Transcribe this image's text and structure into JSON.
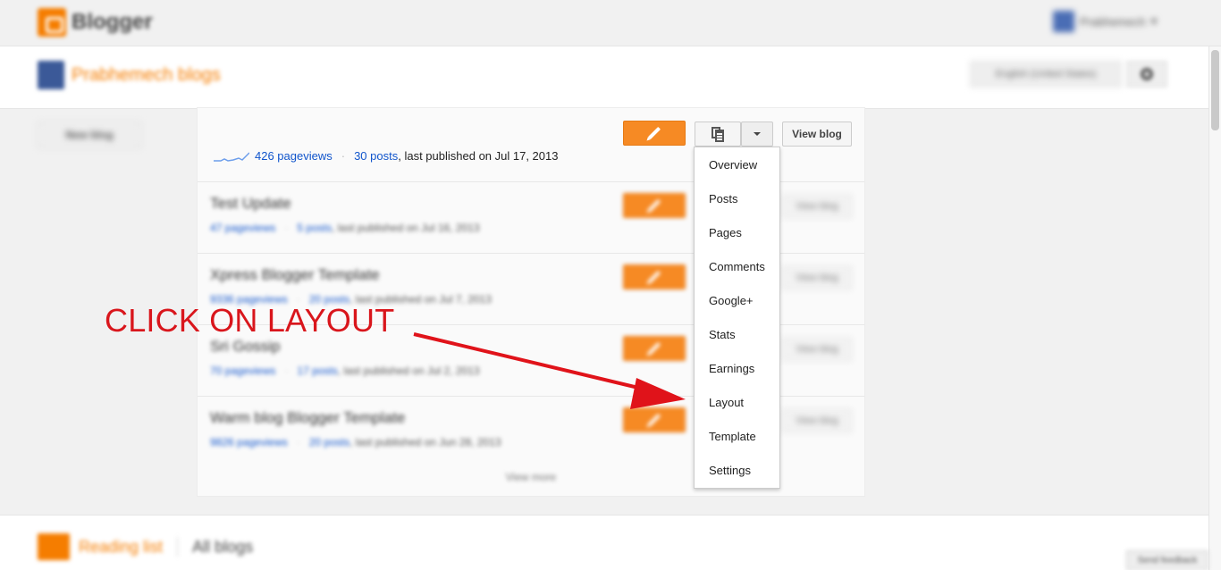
{
  "header": {
    "app_name": "Blogger",
    "user_name": "Prabhemech"
  },
  "profile": {
    "name": "Prabhemech blogs",
    "language": "English (United States)"
  },
  "sidebar": {
    "new_blog_label": "New blog"
  },
  "blogs": {
    "first": {
      "pageviews": "426 pageviews",
      "posts": "30 posts",
      "last_published": ", last published on Jul 17, 2013",
      "view_blog_label": "View blog"
    },
    "rows": [
      {
        "title": "Test Update",
        "pageviews": "47 pageviews",
        "posts": "5 posts",
        "last_published": ", last published on Jul 16, 2013",
        "view_blog_label": "View blog"
      },
      {
        "title": "Xpress Blogger Template",
        "pageviews": "9336 pageviews",
        "posts": "20 posts",
        "last_published": ", last published on Jul 7, 2013",
        "view_blog_label": "View blog"
      },
      {
        "title": "Sri Gossip",
        "pageviews": "70 pageviews",
        "posts": "17 posts",
        "last_published": ", last published on Jul 2, 2013",
        "view_blog_label": "View blog"
      },
      {
        "title": "Warm blog Blogger Template",
        "pageviews": "9826 pageviews",
        "posts": "20 posts",
        "last_published": ", last published on Jun 28, 2013",
        "view_blog_label": "View blog"
      }
    ],
    "view_more": "View more"
  },
  "menu": {
    "items": [
      "Overview",
      "Posts",
      "Pages",
      "Comments",
      "Google+",
      "Stats",
      "Earnings",
      "Layout",
      "Template",
      "Settings"
    ]
  },
  "reading_list": {
    "title": "Reading list",
    "filter": "All blogs"
  },
  "feedback_label": "Send feedback",
  "annotation": {
    "text": "CLICK ON LAYOUT",
    "color": "#d9161c"
  },
  "colors": {
    "accent_orange": "#f68a24",
    "link_blue": "#1155cc"
  },
  "icons": {
    "edit": "pencil-icon",
    "manage": "document-copy-icon",
    "dropdown": "caret-down-icon",
    "settings": "gear-icon"
  }
}
